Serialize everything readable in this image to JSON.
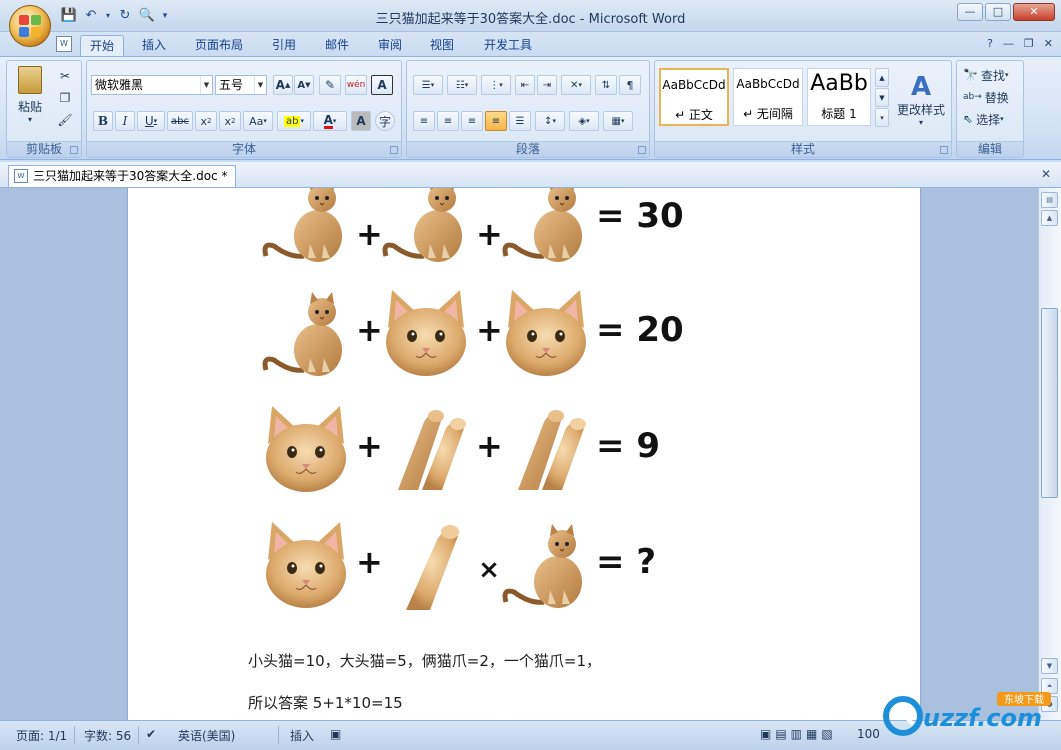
{
  "window": {
    "title": "三只猫加起来等于30答案大全.doc - Microsoft Word",
    "controls": {
      "minimize": "—",
      "maximize": "□",
      "close": "✕"
    }
  },
  "ribbon_tabs": [
    "开始",
    "插入",
    "页面布局",
    "引用",
    "邮件",
    "审阅",
    "视图",
    "开发工具"
  ],
  "active_tab": "开始",
  "groups": {
    "clipboard": {
      "label": "剪贴板",
      "paste": "粘贴"
    },
    "font": {
      "label": "字体",
      "font_name": "微软雅黑",
      "font_size": "五号"
    },
    "paragraph": {
      "label": "段落"
    },
    "styles": {
      "label": "样式",
      "items": [
        {
          "sample": "AaBbCcDd",
          "name": "↵ 正文"
        },
        {
          "sample": "AaBbCcDd",
          "name": "↵ 无间隔"
        },
        {
          "sample": "AaBb",
          "name": "标题 1"
        }
      ],
      "change_styles": "更改样式"
    },
    "editing": {
      "label": "编辑",
      "find": "查找",
      "replace": "替换",
      "select": "选择"
    }
  },
  "document_tab": "三只猫加起来等于30答案大全.doc *",
  "puzzle": {
    "rows": [
      {
        "result": "= 30"
      },
      {
        "result": "= 20"
      },
      {
        "result": "= 9"
      },
      {
        "result": "= ?"
      }
    ]
  },
  "body_text": {
    "line1": "小头猫=10，大头猫=5，俩猫爪=2，一个猫爪=1，",
    "line2": "所以答案 5+1*10=15"
  },
  "statusbar": {
    "page": "页面: 1/1",
    "words": "字数: 56",
    "language": "英语(美国)",
    "mode": "插入",
    "zoom": "100"
  },
  "watermark": {
    "text": "uzzf.com",
    "tag": "东坡下载"
  },
  "colors": {
    "accent": "#15428b",
    "ribbon_bg": "#dbe7f6",
    "cat_fur": "#d9a665"
  }
}
